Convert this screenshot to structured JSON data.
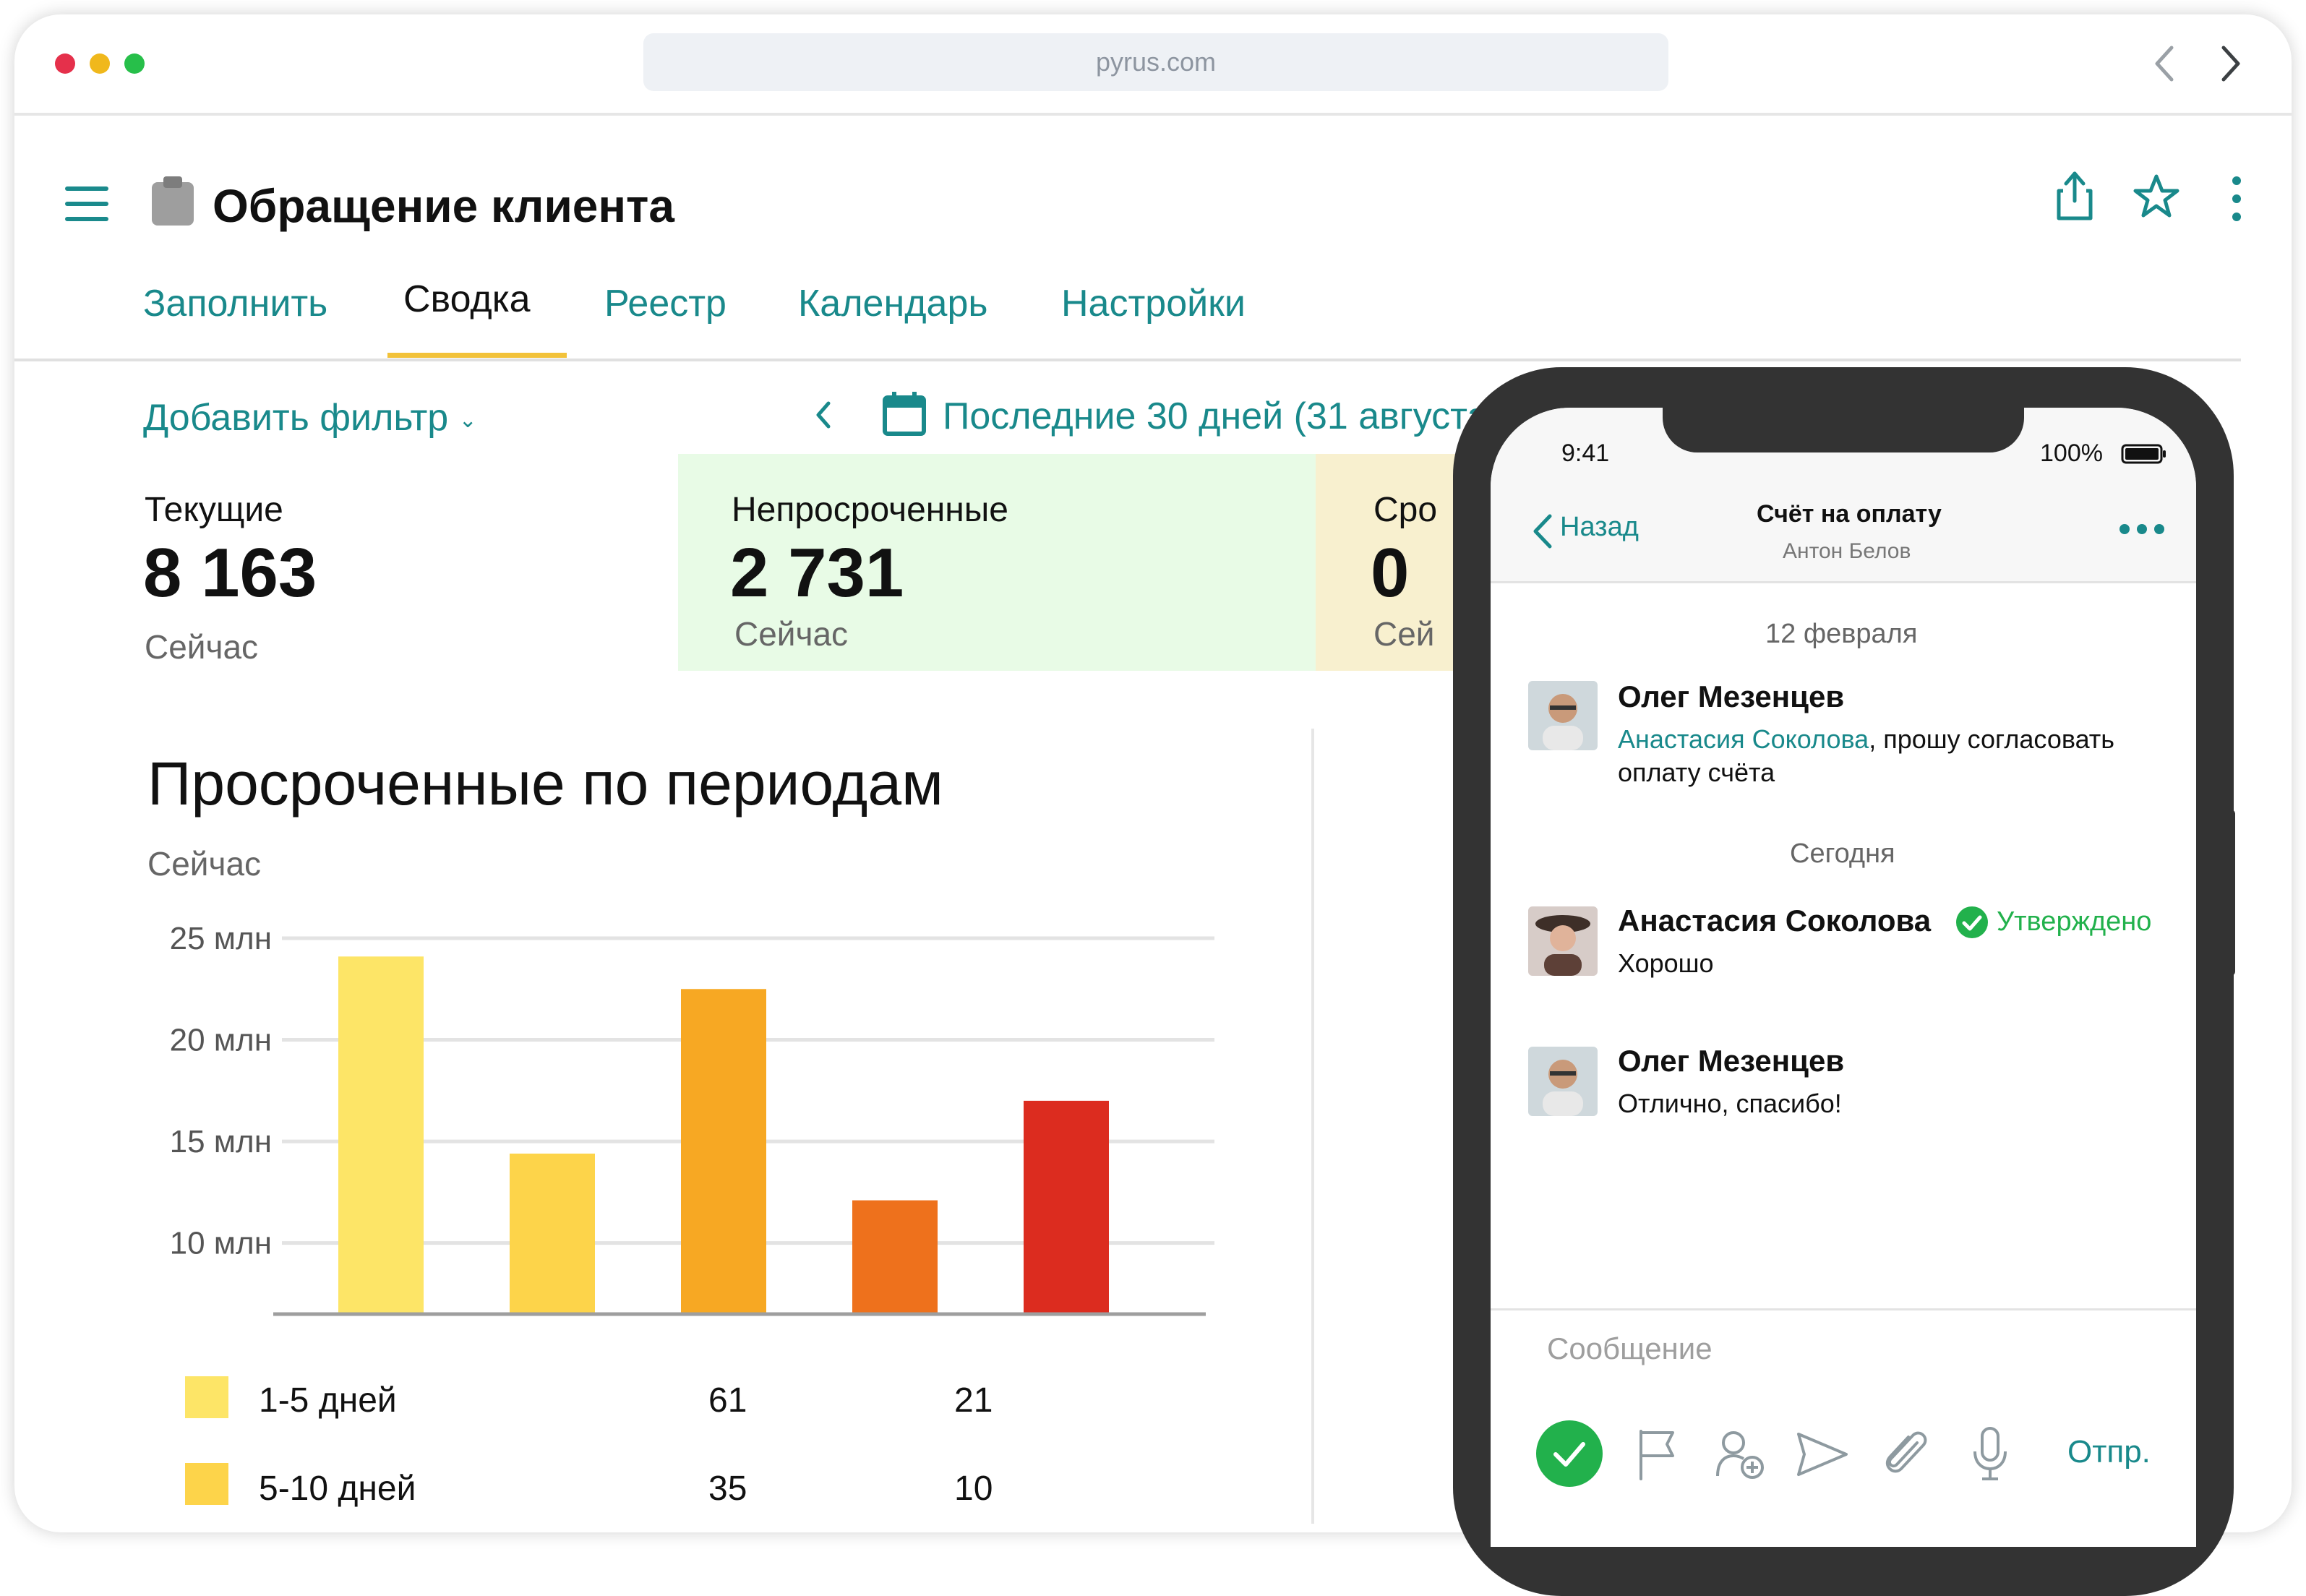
{
  "browser": {
    "url": "pyrus.com"
  },
  "header": {
    "title": "Обращение клиента"
  },
  "tabs": [
    {
      "label": "Заполнить"
    },
    {
      "label": "Сводка"
    },
    {
      "label": "Реестр"
    },
    {
      "label": "Календарь"
    },
    {
      "label": "Настройки"
    }
  ],
  "toolbar": {
    "filter_label": "Добавить фильтр",
    "period_label": "Последние 30 дней (31 августа"
  },
  "kpis": [
    {
      "label": "Текущие",
      "value": "8 163",
      "sub": "Сейчас"
    },
    {
      "label": "Непросроченные",
      "value": "2 731",
      "sub": "Сейчас"
    },
    {
      "label": "Сро",
      "value": "0",
      "sub": "Сей"
    }
  ],
  "chart": {
    "title": "Просроченные по периодам",
    "subtitle": "Сейчас"
  },
  "chart_data": {
    "type": "bar",
    "title": "Просроченные по периодам",
    "ytick_labels": [
      "25 млн",
      "20 млн",
      "15 млн",
      "10 млн"
    ],
    "yticks": [
      25,
      20,
      15,
      10
    ],
    "ylim": [
      6.5,
      25
    ],
    "values": [
      24.1,
      14.4,
      22.5,
      12.1,
      17.0
    ],
    "colors": [
      "#fde567",
      "#fdd44a",
      "#f7a823",
      "#ee711c",
      "#dc2c1f"
    ],
    "grid": true
  },
  "legend_table": [
    {
      "label": "1-5 дней",
      "v1": "61",
      "v2": "21",
      "color": "#fde567"
    },
    {
      "label": "5-10 дней",
      "v1": "35",
      "v2": "10",
      "color": "#fdd44a"
    }
  ],
  "phone": {
    "time": "9:41",
    "battery": "100%",
    "back_label": "Назад",
    "chat_title": "Счёт на оплату",
    "chat_subtitle": "Антон Белов",
    "date1": "12 февраля",
    "msg1": {
      "author": "Олег Мезенцев",
      "mention": "Анастасия Соколова",
      "text1": ", прошу согласовать",
      "text2": "оплату счёта"
    },
    "date2": "Сегодня",
    "msg2": {
      "author": "Анастасия Соколова",
      "status": "Утверждено",
      "text": "Хорошо"
    },
    "msg3": {
      "author": "Олег Мезенцев",
      "text": "Отлично, спасибо!"
    },
    "input_placeholder": "Сообщение",
    "send_label": "Отпр."
  }
}
